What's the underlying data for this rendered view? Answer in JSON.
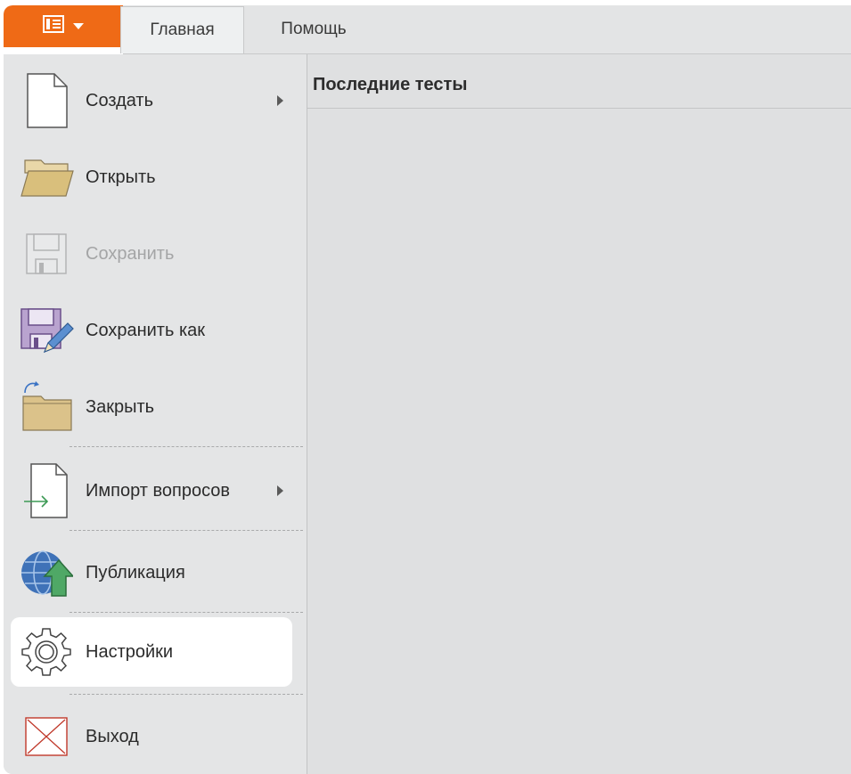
{
  "ribbon": {
    "tabs": [
      {
        "label": "Главная",
        "selected": true
      },
      {
        "label": "Помощь",
        "selected": false
      }
    ],
    "file_button_icon": "backstage-menu-icon",
    "accent": "#ef6a16"
  },
  "menu": {
    "items": [
      {
        "label": "Создать",
        "icon": "new-file-icon",
        "submenu": true
      },
      {
        "label": "Открыть",
        "icon": "open-folder-icon"
      },
      {
        "label": "Сохранить",
        "icon": "save-icon",
        "disabled": true
      },
      {
        "label": "Сохранить как",
        "icon": "save-as-icon"
      },
      {
        "label": "Закрыть",
        "icon": "close-folder-icon"
      },
      {
        "label": "Импорт вопросов",
        "icon": "import-icon",
        "submenu": true
      },
      {
        "label": "Публикация",
        "icon": "publish-icon"
      },
      {
        "label": "Настройки",
        "icon": "settings-gear-icon",
        "active": true
      },
      {
        "label": "Выход",
        "icon": "exit-icon"
      }
    ]
  },
  "content": {
    "title": "Последние тесты"
  }
}
